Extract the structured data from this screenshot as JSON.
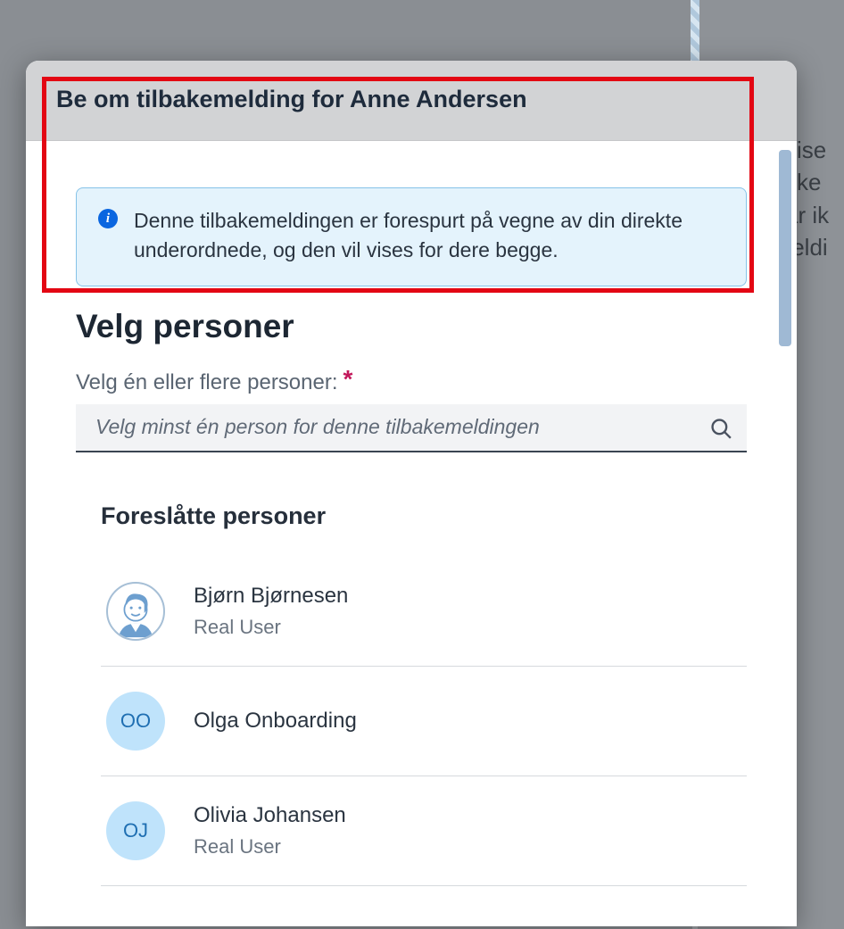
{
  "background_snippets": [
    "vise",
    "kke",
    "ar ik",
    "ıeldi"
  ],
  "modal": {
    "title": "Be om tilbakemelding for Anne Andersen",
    "info_message": "Denne tilbakemeldingen er forespurt på vegne av din direkte underordnede, og den vil vises for dere begge.",
    "section_heading": "Velg personer",
    "field_label": "Velg én eller flere personer:",
    "search_placeholder": "Velg minst én person for denne tilbakemeldingen",
    "suggested_heading": "Foreslåtte personer",
    "suggested": [
      {
        "name": "Bjørn Bjørnesen",
        "role": "Real User",
        "initials": "",
        "avatar_type": "photo"
      },
      {
        "name": "Olga Onboarding",
        "role": "",
        "initials": "OO",
        "avatar_type": "initials"
      },
      {
        "name": "Olivia Johansen",
        "role": "Real User",
        "initials": "OJ",
        "avatar_type": "initials"
      }
    ]
  },
  "icons": {
    "info": "i"
  }
}
